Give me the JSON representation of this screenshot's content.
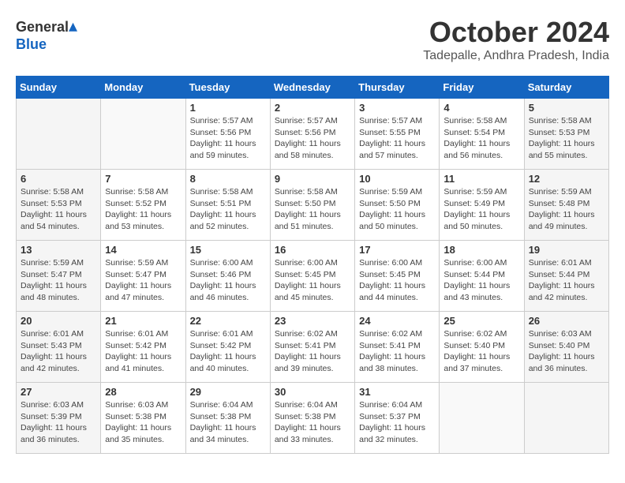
{
  "header": {
    "logo_general": "General",
    "logo_blue": "Blue",
    "month": "October 2024",
    "location": "Tadepalle, Andhra Pradesh, India"
  },
  "days_of_week": [
    "Sunday",
    "Monday",
    "Tuesday",
    "Wednesday",
    "Thursday",
    "Friday",
    "Saturday"
  ],
  "weeks": [
    [
      {
        "day": "",
        "info": ""
      },
      {
        "day": "",
        "info": ""
      },
      {
        "day": "1",
        "info": "Sunrise: 5:57 AM\nSunset: 5:56 PM\nDaylight: 11 hours and 59 minutes."
      },
      {
        "day": "2",
        "info": "Sunrise: 5:57 AM\nSunset: 5:56 PM\nDaylight: 11 hours and 58 minutes."
      },
      {
        "day": "3",
        "info": "Sunrise: 5:57 AM\nSunset: 5:55 PM\nDaylight: 11 hours and 57 minutes."
      },
      {
        "day": "4",
        "info": "Sunrise: 5:58 AM\nSunset: 5:54 PM\nDaylight: 11 hours and 56 minutes."
      },
      {
        "day": "5",
        "info": "Sunrise: 5:58 AM\nSunset: 5:53 PM\nDaylight: 11 hours and 55 minutes."
      }
    ],
    [
      {
        "day": "6",
        "info": "Sunrise: 5:58 AM\nSunset: 5:53 PM\nDaylight: 11 hours and 54 minutes."
      },
      {
        "day": "7",
        "info": "Sunrise: 5:58 AM\nSunset: 5:52 PM\nDaylight: 11 hours and 53 minutes."
      },
      {
        "day": "8",
        "info": "Sunrise: 5:58 AM\nSunset: 5:51 PM\nDaylight: 11 hours and 52 minutes."
      },
      {
        "day": "9",
        "info": "Sunrise: 5:58 AM\nSunset: 5:50 PM\nDaylight: 11 hours and 51 minutes."
      },
      {
        "day": "10",
        "info": "Sunrise: 5:59 AM\nSunset: 5:50 PM\nDaylight: 11 hours and 50 minutes."
      },
      {
        "day": "11",
        "info": "Sunrise: 5:59 AM\nSunset: 5:49 PM\nDaylight: 11 hours and 50 minutes."
      },
      {
        "day": "12",
        "info": "Sunrise: 5:59 AM\nSunset: 5:48 PM\nDaylight: 11 hours and 49 minutes."
      }
    ],
    [
      {
        "day": "13",
        "info": "Sunrise: 5:59 AM\nSunset: 5:47 PM\nDaylight: 11 hours and 48 minutes."
      },
      {
        "day": "14",
        "info": "Sunrise: 5:59 AM\nSunset: 5:47 PM\nDaylight: 11 hours and 47 minutes."
      },
      {
        "day": "15",
        "info": "Sunrise: 6:00 AM\nSunset: 5:46 PM\nDaylight: 11 hours and 46 minutes."
      },
      {
        "day": "16",
        "info": "Sunrise: 6:00 AM\nSunset: 5:45 PM\nDaylight: 11 hours and 45 minutes."
      },
      {
        "day": "17",
        "info": "Sunrise: 6:00 AM\nSunset: 5:45 PM\nDaylight: 11 hours and 44 minutes."
      },
      {
        "day": "18",
        "info": "Sunrise: 6:00 AM\nSunset: 5:44 PM\nDaylight: 11 hours and 43 minutes."
      },
      {
        "day": "19",
        "info": "Sunrise: 6:01 AM\nSunset: 5:44 PM\nDaylight: 11 hours and 42 minutes."
      }
    ],
    [
      {
        "day": "20",
        "info": "Sunrise: 6:01 AM\nSunset: 5:43 PM\nDaylight: 11 hours and 42 minutes."
      },
      {
        "day": "21",
        "info": "Sunrise: 6:01 AM\nSunset: 5:42 PM\nDaylight: 11 hours and 41 minutes."
      },
      {
        "day": "22",
        "info": "Sunrise: 6:01 AM\nSunset: 5:42 PM\nDaylight: 11 hours and 40 minutes."
      },
      {
        "day": "23",
        "info": "Sunrise: 6:02 AM\nSunset: 5:41 PM\nDaylight: 11 hours and 39 minutes."
      },
      {
        "day": "24",
        "info": "Sunrise: 6:02 AM\nSunset: 5:41 PM\nDaylight: 11 hours and 38 minutes."
      },
      {
        "day": "25",
        "info": "Sunrise: 6:02 AM\nSunset: 5:40 PM\nDaylight: 11 hours and 37 minutes."
      },
      {
        "day": "26",
        "info": "Sunrise: 6:03 AM\nSunset: 5:40 PM\nDaylight: 11 hours and 36 minutes."
      }
    ],
    [
      {
        "day": "27",
        "info": "Sunrise: 6:03 AM\nSunset: 5:39 PM\nDaylight: 11 hours and 36 minutes."
      },
      {
        "day": "28",
        "info": "Sunrise: 6:03 AM\nSunset: 5:38 PM\nDaylight: 11 hours and 35 minutes."
      },
      {
        "day": "29",
        "info": "Sunrise: 6:04 AM\nSunset: 5:38 PM\nDaylight: 11 hours and 34 minutes."
      },
      {
        "day": "30",
        "info": "Sunrise: 6:04 AM\nSunset: 5:38 PM\nDaylight: 11 hours and 33 minutes."
      },
      {
        "day": "31",
        "info": "Sunrise: 6:04 AM\nSunset: 5:37 PM\nDaylight: 11 hours and 32 minutes."
      },
      {
        "day": "",
        "info": ""
      },
      {
        "day": "",
        "info": ""
      }
    ]
  ]
}
